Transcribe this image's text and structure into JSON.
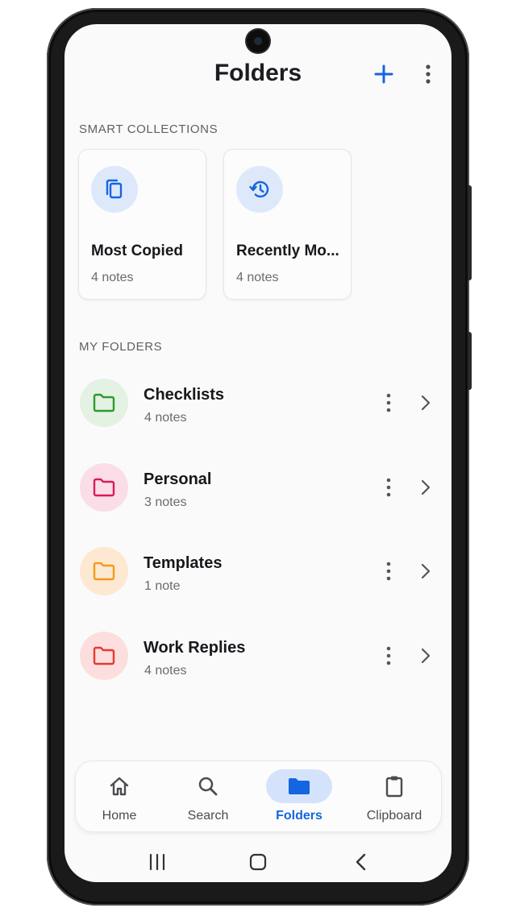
{
  "header": {
    "title": "Folders"
  },
  "smart_collections": {
    "label": "SMART COLLECTIONS",
    "items": [
      {
        "title": "Most Copied",
        "count": "4 notes",
        "icon": "copy-icon"
      },
      {
        "title": "Recently Mo...",
        "count": "4 notes",
        "icon": "history-icon"
      }
    ]
  },
  "my_folders": {
    "label": "MY FOLDERS",
    "items": [
      {
        "name": "Checklists",
        "count": "4 notes",
        "color": "#2e9a2e",
        "bg": "#e3f2e3"
      },
      {
        "name": "Personal",
        "count": "3 notes",
        "color": "#d81b60",
        "bg": "#fbdde7"
      },
      {
        "name": "Templates",
        "count": "1 note",
        "color": "#f29a1c",
        "bg": "#fde9d2"
      },
      {
        "name": "Work Replies",
        "count": "4 notes",
        "color": "#e53935",
        "bg": "#fcdede"
      }
    ]
  },
  "bottom_nav": {
    "items": [
      {
        "label": "Home",
        "icon": "home-icon"
      },
      {
        "label": "Search",
        "icon": "search-icon"
      },
      {
        "label": "Folders",
        "icon": "folder-icon",
        "active": true
      },
      {
        "label": "Clipboard",
        "icon": "clipboard-icon"
      }
    ]
  },
  "colors": {
    "accent": "#1565e0",
    "accent_soft": "#d4e3fb",
    "card_icon_bg": "#dde9fb"
  }
}
